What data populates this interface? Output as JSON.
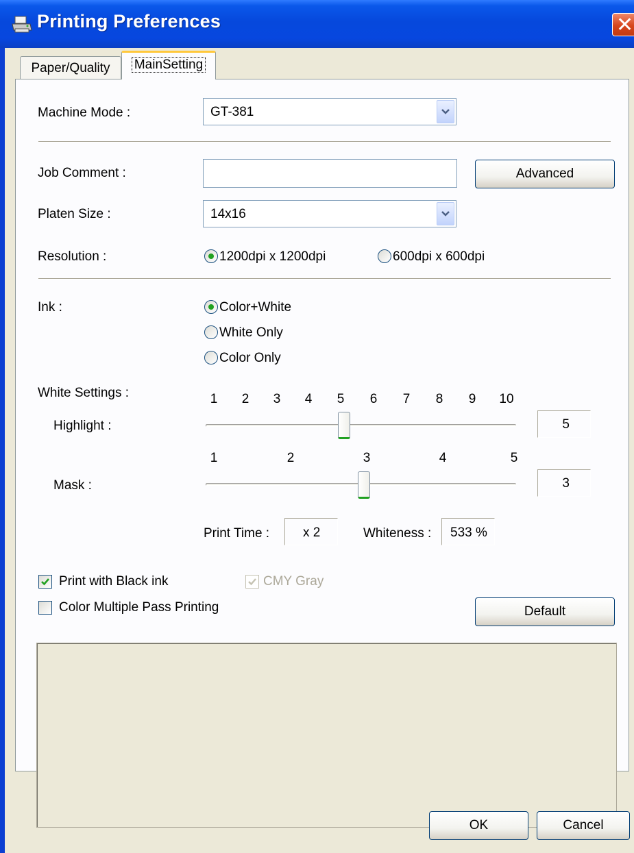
{
  "window": {
    "title": "Printing Preferences",
    "close_label": "✕"
  },
  "tabs": [
    {
      "label": "Paper/Quality",
      "active": false
    },
    {
      "label": "MainSetting",
      "active": true
    }
  ],
  "machine_mode": {
    "label": "Machine Mode :",
    "value": "GT-381"
  },
  "job_comment": {
    "label": "Job Comment :",
    "value": "",
    "advanced_label": "Advanced"
  },
  "platen_size": {
    "label": "Platen Size :",
    "value": "14x16"
  },
  "resolution": {
    "label": "Resolution :",
    "options": [
      {
        "label": "1200dpi x 1200dpi",
        "selected": true
      },
      {
        "label": "600dpi x 600dpi",
        "selected": false
      }
    ]
  },
  "ink": {
    "label": "Ink :",
    "options": [
      {
        "label": "Color+White",
        "selected": true
      },
      {
        "label": "White Only",
        "selected": false
      },
      {
        "label": "Color Only",
        "selected": false
      }
    ]
  },
  "white_settings": {
    "label": "White Settings :",
    "highlight": {
      "label": "Highlight :",
      "ticks": [
        "1",
        "2",
        "3",
        "4",
        "5",
        "6",
        "7",
        "8",
        "9",
        "10"
      ],
      "value": "5",
      "min": 1,
      "max": 10,
      "position": 5
    },
    "mask": {
      "label": "Mask :",
      "ticks": [
        "1",
        "2",
        "3",
        "4",
        "5"
      ],
      "value": "3",
      "min": 1,
      "max": 5,
      "position": 3
    },
    "print_time_label": "Print Time :",
    "print_time_value": "x 2",
    "whiteness_label": "Whiteness :",
    "whiteness_value": "533 %"
  },
  "options": {
    "print_black_ink": {
      "label": "Print with Black ink",
      "checked": true
    },
    "cmy_gray": {
      "label": "CMY Gray",
      "checked": true,
      "disabled": true
    },
    "color_multipass": {
      "label": "Color Multiple Pass Printing",
      "checked": false
    },
    "default_label": "Default"
  },
  "footer": {
    "ok_label": "OK",
    "cancel_label": "Cancel"
  },
  "colors": {
    "title_bar": "#0648dc",
    "dialog_bg": "#ece9d8",
    "radio_dot": "#21a121",
    "tab_highlight": "#ffc83c",
    "close_button": "#d7451c"
  }
}
